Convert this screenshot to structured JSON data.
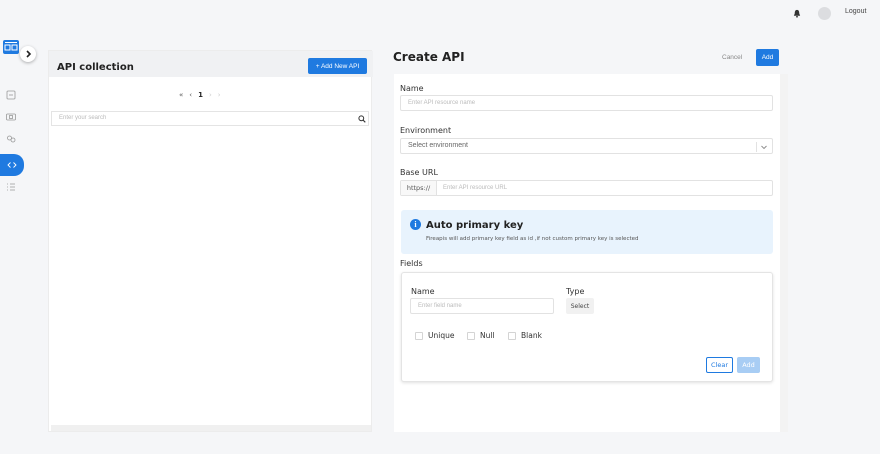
{
  "topbar": {
    "logout_label": "Logout",
    "icons": [
      "bell-icon",
      "avatar"
    ]
  },
  "rail": {
    "icons": [
      "app-logo-icon",
      "chevron-right-icon",
      "dashboard-icon",
      "database-icon",
      "users-icon",
      "code-icon",
      "list-icon"
    ]
  },
  "collection": {
    "title": "API collection",
    "add_button": "+ Add New API",
    "pager": {
      "first": "«",
      "prev": "‹",
      "current": "1",
      "next": "›",
      "last": "›"
    },
    "search_placeholder": "Enter your search"
  },
  "create": {
    "title": "Create API",
    "cancel_label": "Cancel",
    "add_label": "Add",
    "name_label": "Name",
    "name_placeholder": "Enter API resource name",
    "env_label": "Environment",
    "env_placeholder": "Select environment",
    "base_url_label": "Base URL",
    "base_url_prefix": "https://",
    "base_url_placeholder": "Enter API resource URL",
    "info": {
      "title": "Auto primary key",
      "text": "Fireapis will add primary key field as id ,if not custom primary key is selected"
    },
    "fields_label": "Fields",
    "field": {
      "name_label": "Name",
      "name_placeholder": "Enter field name",
      "type_label": "Type",
      "type_select": "Select",
      "unique_label": "Unique",
      "null_label": "Null",
      "blank_label": "Blank",
      "clear_label": "Clear",
      "add_label": "Add"
    }
  },
  "colors": {
    "primary": "#1f7ae0",
    "info_bg": "#e8f3fd",
    "disabled": "#a8cdf4"
  }
}
